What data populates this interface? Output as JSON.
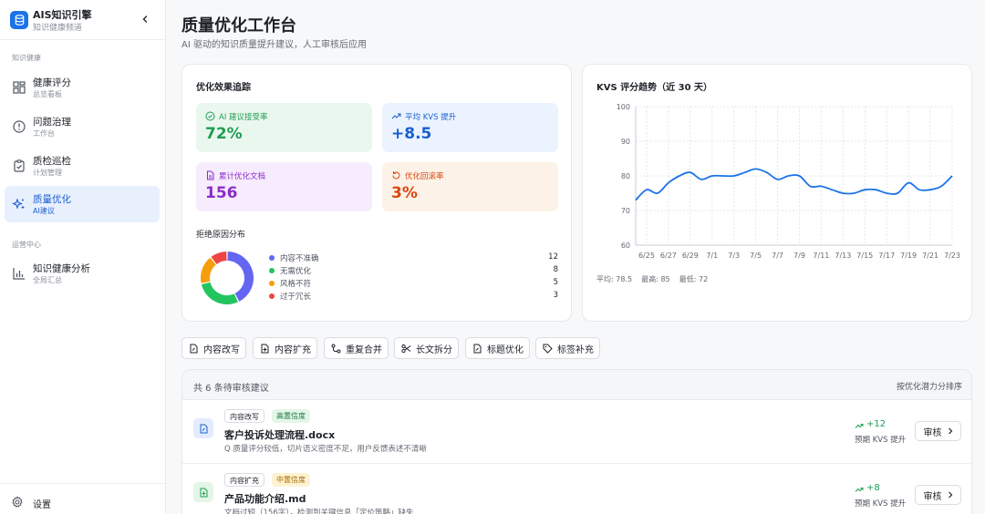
{
  "brand": {
    "title": "AIS知识引擎",
    "subtitle": "知识健康频道"
  },
  "sidebar": {
    "sections": [
      {
        "label": "知识健康"
      },
      {
        "label": "运营中心"
      }
    ],
    "items": [
      {
        "label": "健康评分",
        "sub": "总览看板",
        "icon": "grid-icon"
      },
      {
        "label": "问题治理",
        "sub": "工作台",
        "icon": "alert-circle-icon"
      },
      {
        "label": "质检巡检",
        "sub": "计划管理",
        "icon": "clipboard-check-icon"
      },
      {
        "label": "质量优化",
        "sub": "AI建议",
        "icon": "sparkles-icon",
        "active": true
      },
      {
        "label": "知识健康分析",
        "sub": "全局汇总",
        "icon": "bar-chart-icon"
      }
    ],
    "settings": "设置"
  },
  "header": {
    "title": "质量优化工作台",
    "subtitle": "AI 驱动的知识质量提升建议，人工审核后应用"
  },
  "effect": {
    "title": "优化效果追踪",
    "metrics": [
      {
        "label": "AI 建议接受率",
        "value": "72%",
        "icon": "check-circle-icon",
        "bg": "#eaf7ee",
        "color": "#1f9d55"
      },
      {
        "label": "平均 KVS 提升",
        "value": "+8.5",
        "icon": "trending-up-icon",
        "bg": "#ebf3fe",
        "color": "#1a5fd0"
      },
      {
        "label": "累计优化文档",
        "value": "156",
        "icon": "document-icon",
        "bg": "#f6ecfd",
        "color": "#8a2cc9"
      },
      {
        "label": "优化回滚率",
        "value": "3%",
        "icon": "rotate-icon",
        "bg": "#fdf2e7",
        "color": "#d9480f"
      }
    ],
    "reasons_title": "拒绝原因分布",
    "reasons": [
      {
        "name": "内容不准确",
        "count": 12,
        "color": "#6366f1"
      },
      {
        "name": "无需优化",
        "count": 8,
        "color": "#22c55e"
      },
      {
        "name": "风格不符",
        "count": 5,
        "color": "#f59e0b"
      },
      {
        "name": "过于冗长",
        "count": 3,
        "color": "#ef4444"
      }
    ]
  },
  "trend": {
    "title": "KVS 评分趋势（近 30 天）",
    "stats": "平均: 78.5    最高: 85    最低: 72"
  },
  "chart_data": {
    "type": "line",
    "title": "KVS 评分趋势（近 30 天）",
    "x_ticks": [
      "6/25",
      "6/27",
      "6/29",
      "7/1",
      "7/3",
      "7/5",
      "7/7",
      "7/9",
      "7/11",
      "7/13",
      "7/15",
      "7/17",
      "7/19",
      "7/21",
      "7/23"
    ],
    "y_ticks": [
      60,
      70,
      80,
      90,
      100
    ],
    "ylim": [
      60,
      100
    ],
    "grid": true,
    "color": "#1a73e8",
    "x": [
      "6/24",
      "6/25",
      "6/26",
      "6/27",
      "6/28",
      "6/29",
      "6/30",
      "7/1",
      "7/2",
      "7/3",
      "7/4",
      "7/5",
      "7/6",
      "7/7",
      "7/8",
      "7/9",
      "7/10",
      "7/11",
      "7/12",
      "7/13",
      "7/14",
      "7/15",
      "7/16",
      "7/17",
      "7/18",
      "7/19",
      "7/20",
      "7/21",
      "7/22",
      "7/23"
    ],
    "values": [
      73,
      76,
      75,
      78,
      80,
      81,
      79,
      80,
      80,
      80,
      81,
      82,
      81,
      79,
      80,
      80,
      77,
      77,
      76,
      75,
      75,
      76,
      76,
      75,
      75,
      78,
      76,
      76,
      77,
      80
    ]
  },
  "toolbar": {
    "buttons": [
      {
        "label": "内容改写",
        "icon": "edit-document-icon"
      },
      {
        "label": "内容扩充",
        "icon": "add-document-icon"
      },
      {
        "label": "重复合并",
        "icon": "merge-icon"
      },
      {
        "label": "长文拆分",
        "icon": "scissors-icon"
      },
      {
        "label": "标题优化",
        "icon": "heading-icon"
      },
      {
        "label": "标签补充",
        "icon": "tag-icon"
      }
    ]
  },
  "list": {
    "count_label": "共 6 条待审核建议",
    "sort_label": "按优化潜力分排序",
    "rows": [
      {
        "type": "内容改写",
        "confidence": "高置信度",
        "conf_bg": "#e3f6e8",
        "conf_color": "#1f7a3f",
        "title": "客户投诉处理流程.docx",
        "desc": "Q 质量评分较低，切片语义密度不足，用户反馈表述不清晰",
        "gain": "+12",
        "gain_label": "预期 KVS 提升",
        "action": "审核",
        "icon_bg": "#e3ecfd",
        "icon_color": "#1a5fd0"
      },
      {
        "type": "内容扩充",
        "confidence": "中置信度",
        "conf_bg": "#fdf3d3",
        "conf_color": "#a86b00",
        "title": "产品功能介绍.md",
        "desc": "文档过短（156字），检测到关键信息「定价策略」缺失",
        "gain": "+8",
        "gain_label": "预期 KVS 提升",
        "action": "审核",
        "icon_bg": "#e3f6e8",
        "icon_color": "#1f9d55"
      }
    ]
  }
}
